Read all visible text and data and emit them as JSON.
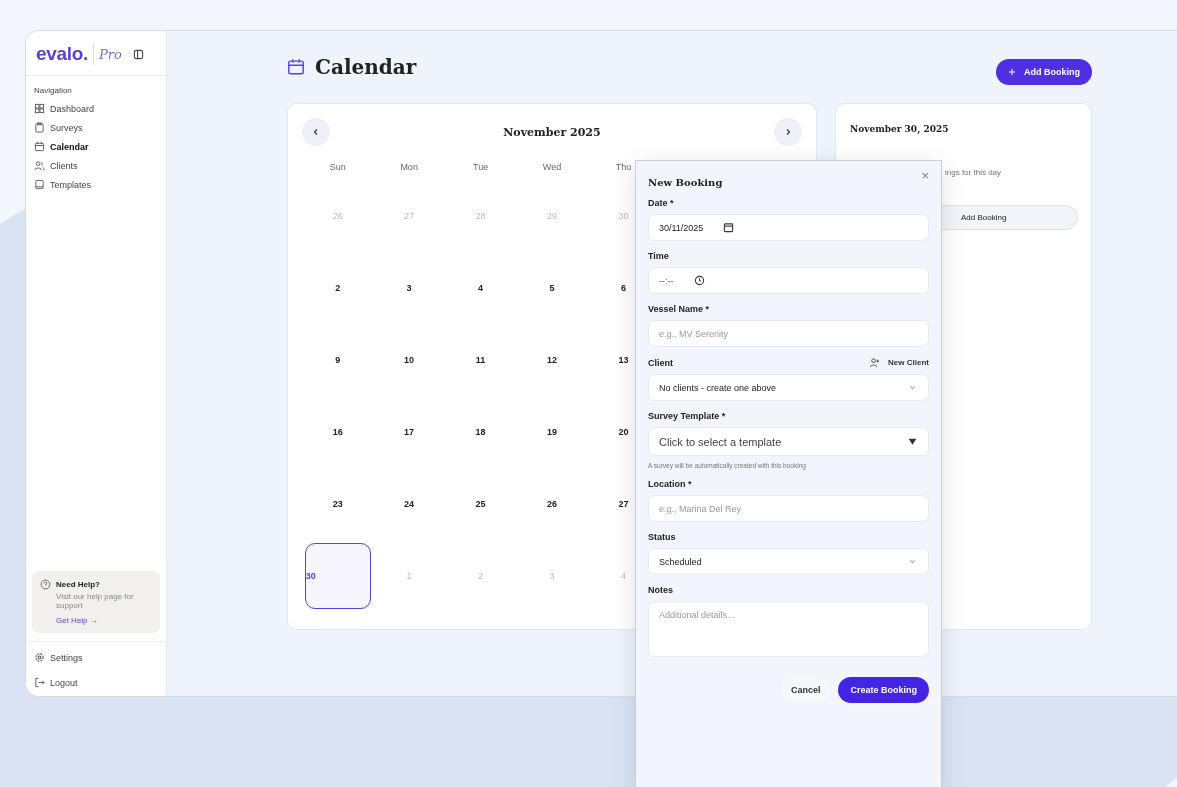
{
  "sidebar": {
    "logo": "evalo.",
    "edition": "Pro",
    "section_label": "Navigation",
    "items": [
      {
        "label": "Dashboard",
        "selected": false
      },
      {
        "label": "Surveys",
        "selected": false
      },
      {
        "label": "Calendar",
        "selected": true
      },
      {
        "label": "Clients",
        "selected": false
      },
      {
        "label": "Templates",
        "selected": false
      }
    ],
    "help": {
      "title": "Need Help?",
      "text": "Visit our help page for support",
      "link": "Get Help →"
    },
    "footer": [
      {
        "label": "Settings"
      },
      {
        "label": "Logout"
      }
    ]
  },
  "page": {
    "title": "Calendar",
    "add_button": "Add Booking"
  },
  "calendar": {
    "month": "November 2025",
    "weekdays": [
      "Sun",
      "Mon",
      "Tue",
      "Wed",
      "Thu"
    ],
    "weeks": [
      [
        {
          "day": "26",
          "muted": true,
          "selected": false
        },
        {
          "day": "27",
          "muted": true,
          "selected": false
        },
        {
          "day": "28",
          "muted": true,
          "selected": false
        },
        {
          "day": "29",
          "muted": true,
          "selected": false
        },
        {
          "day": "30",
          "muted": true,
          "selected": false
        }
      ],
      [
        {
          "day": "2",
          "muted": false,
          "selected": false
        },
        {
          "day": "3",
          "muted": false,
          "selected": false
        },
        {
          "day": "4",
          "muted": false,
          "selected": false
        },
        {
          "day": "5",
          "muted": false,
          "selected": false
        },
        {
          "day": "6",
          "muted": false,
          "selected": false
        }
      ],
      [
        {
          "day": "9",
          "muted": false,
          "selected": false
        },
        {
          "day": "10",
          "muted": false,
          "selected": false
        },
        {
          "day": "11",
          "muted": false,
          "selected": false
        },
        {
          "day": "12",
          "muted": false,
          "selected": false
        },
        {
          "day": "13",
          "muted": false,
          "selected": false
        }
      ],
      [
        {
          "day": "16",
          "muted": false,
          "selected": false
        },
        {
          "day": "17",
          "muted": false,
          "selected": false
        },
        {
          "day": "18",
          "muted": false,
          "selected": false
        },
        {
          "day": "19",
          "muted": false,
          "selected": false
        },
        {
          "day": "20",
          "muted": false,
          "selected": false
        }
      ],
      [
        {
          "day": "23",
          "muted": false,
          "selected": false
        },
        {
          "day": "24",
          "muted": false,
          "selected": false
        },
        {
          "day": "25",
          "muted": false,
          "selected": false
        },
        {
          "day": "26",
          "muted": false,
          "selected": false
        },
        {
          "day": "27",
          "muted": false,
          "selected": false
        }
      ],
      [
        {
          "day": "30",
          "muted": false,
          "selected": true
        },
        {
          "day": "1",
          "muted": true,
          "selected": false
        },
        {
          "day": "2",
          "muted": true,
          "selected": false
        },
        {
          "day": "3",
          "muted": true,
          "selected": false
        },
        {
          "day": "4",
          "muted": true,
          "selected": false
        }
      ]
    ]
  },
  "day_panel": {
    "date": "November 30, 2025",
    "empty_text": "ings for this day",
    "button": "Add Booking"
  },
  "modal": {
    "title": "New Booking",
    "close": "×",
    "fields": [
      {
        "kind": "date",
        "label": "Date *",
        "value": "30/11/2025"
      },
      {
        "kind": "time",
        "label": "Time",
        "value": "--:--"
      },
      {
        "kind": "text",
        "label": "Vessel Name *",
        "placeholder": "e.g., MV Serenity"
      },
      {
        "kind": "select",
        "label": "Client",
        "value": "No clients - create one above",
        "action": "New Client"
      },
      {
        "kind": "template",
        "label": "Survey Template *",
        "value": "Click to select a template",
        "hint": "A survey will be automatically created with this booking"
      },
      {
        "kind": "text",
        "label": "Location *",
        "placeholder": "e.g., Marina Del Rey"
      },
      {
        "kind": "select",
        "label": "Status",
        "value": "Scheduled"
      },
      {
        "kind": "textarea",
        "label": "Notes",
        "placeholder": "Additional details..."
      }
    ],
    "cancel": "Cancel",
    "submit": "Create Booking"
  }
}
